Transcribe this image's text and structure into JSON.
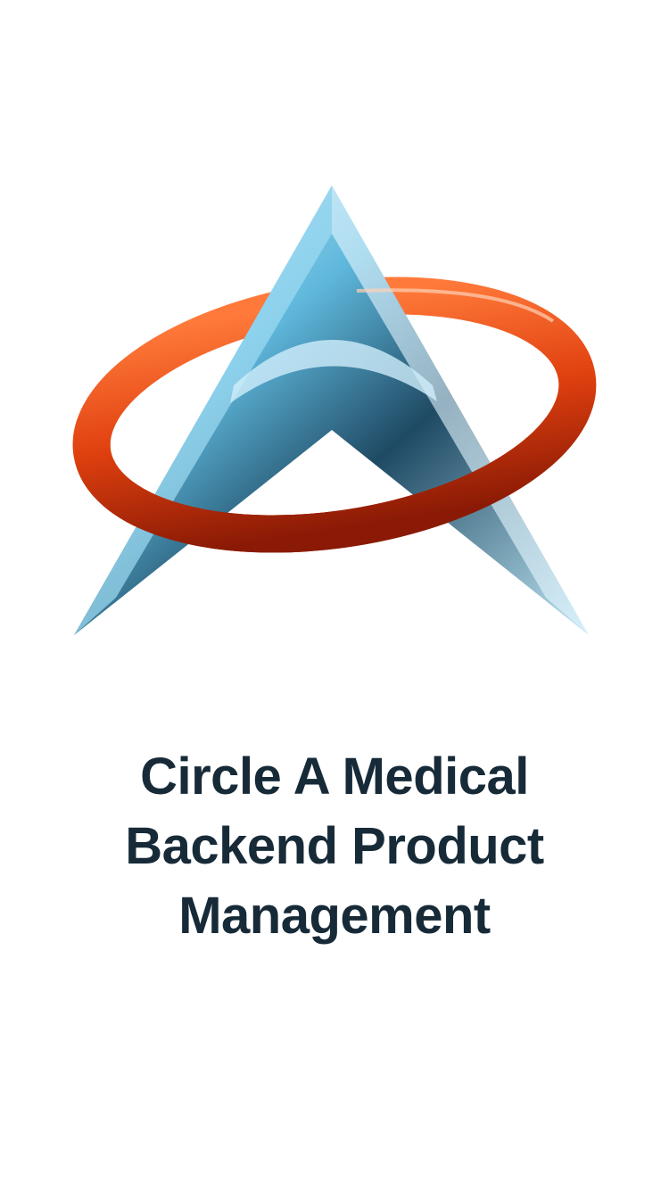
{
  "logo": {
    "name": "Circle A Medical logo",
    "ring_color": "#e0400f",
    "triangle_color": "#5fb8dc"
  },
  "title": {
    "lines": [
      "Circle A Medical",
      "Backend Product",
      "Management"
    ],
    "color": "#172a38"
  }
}
